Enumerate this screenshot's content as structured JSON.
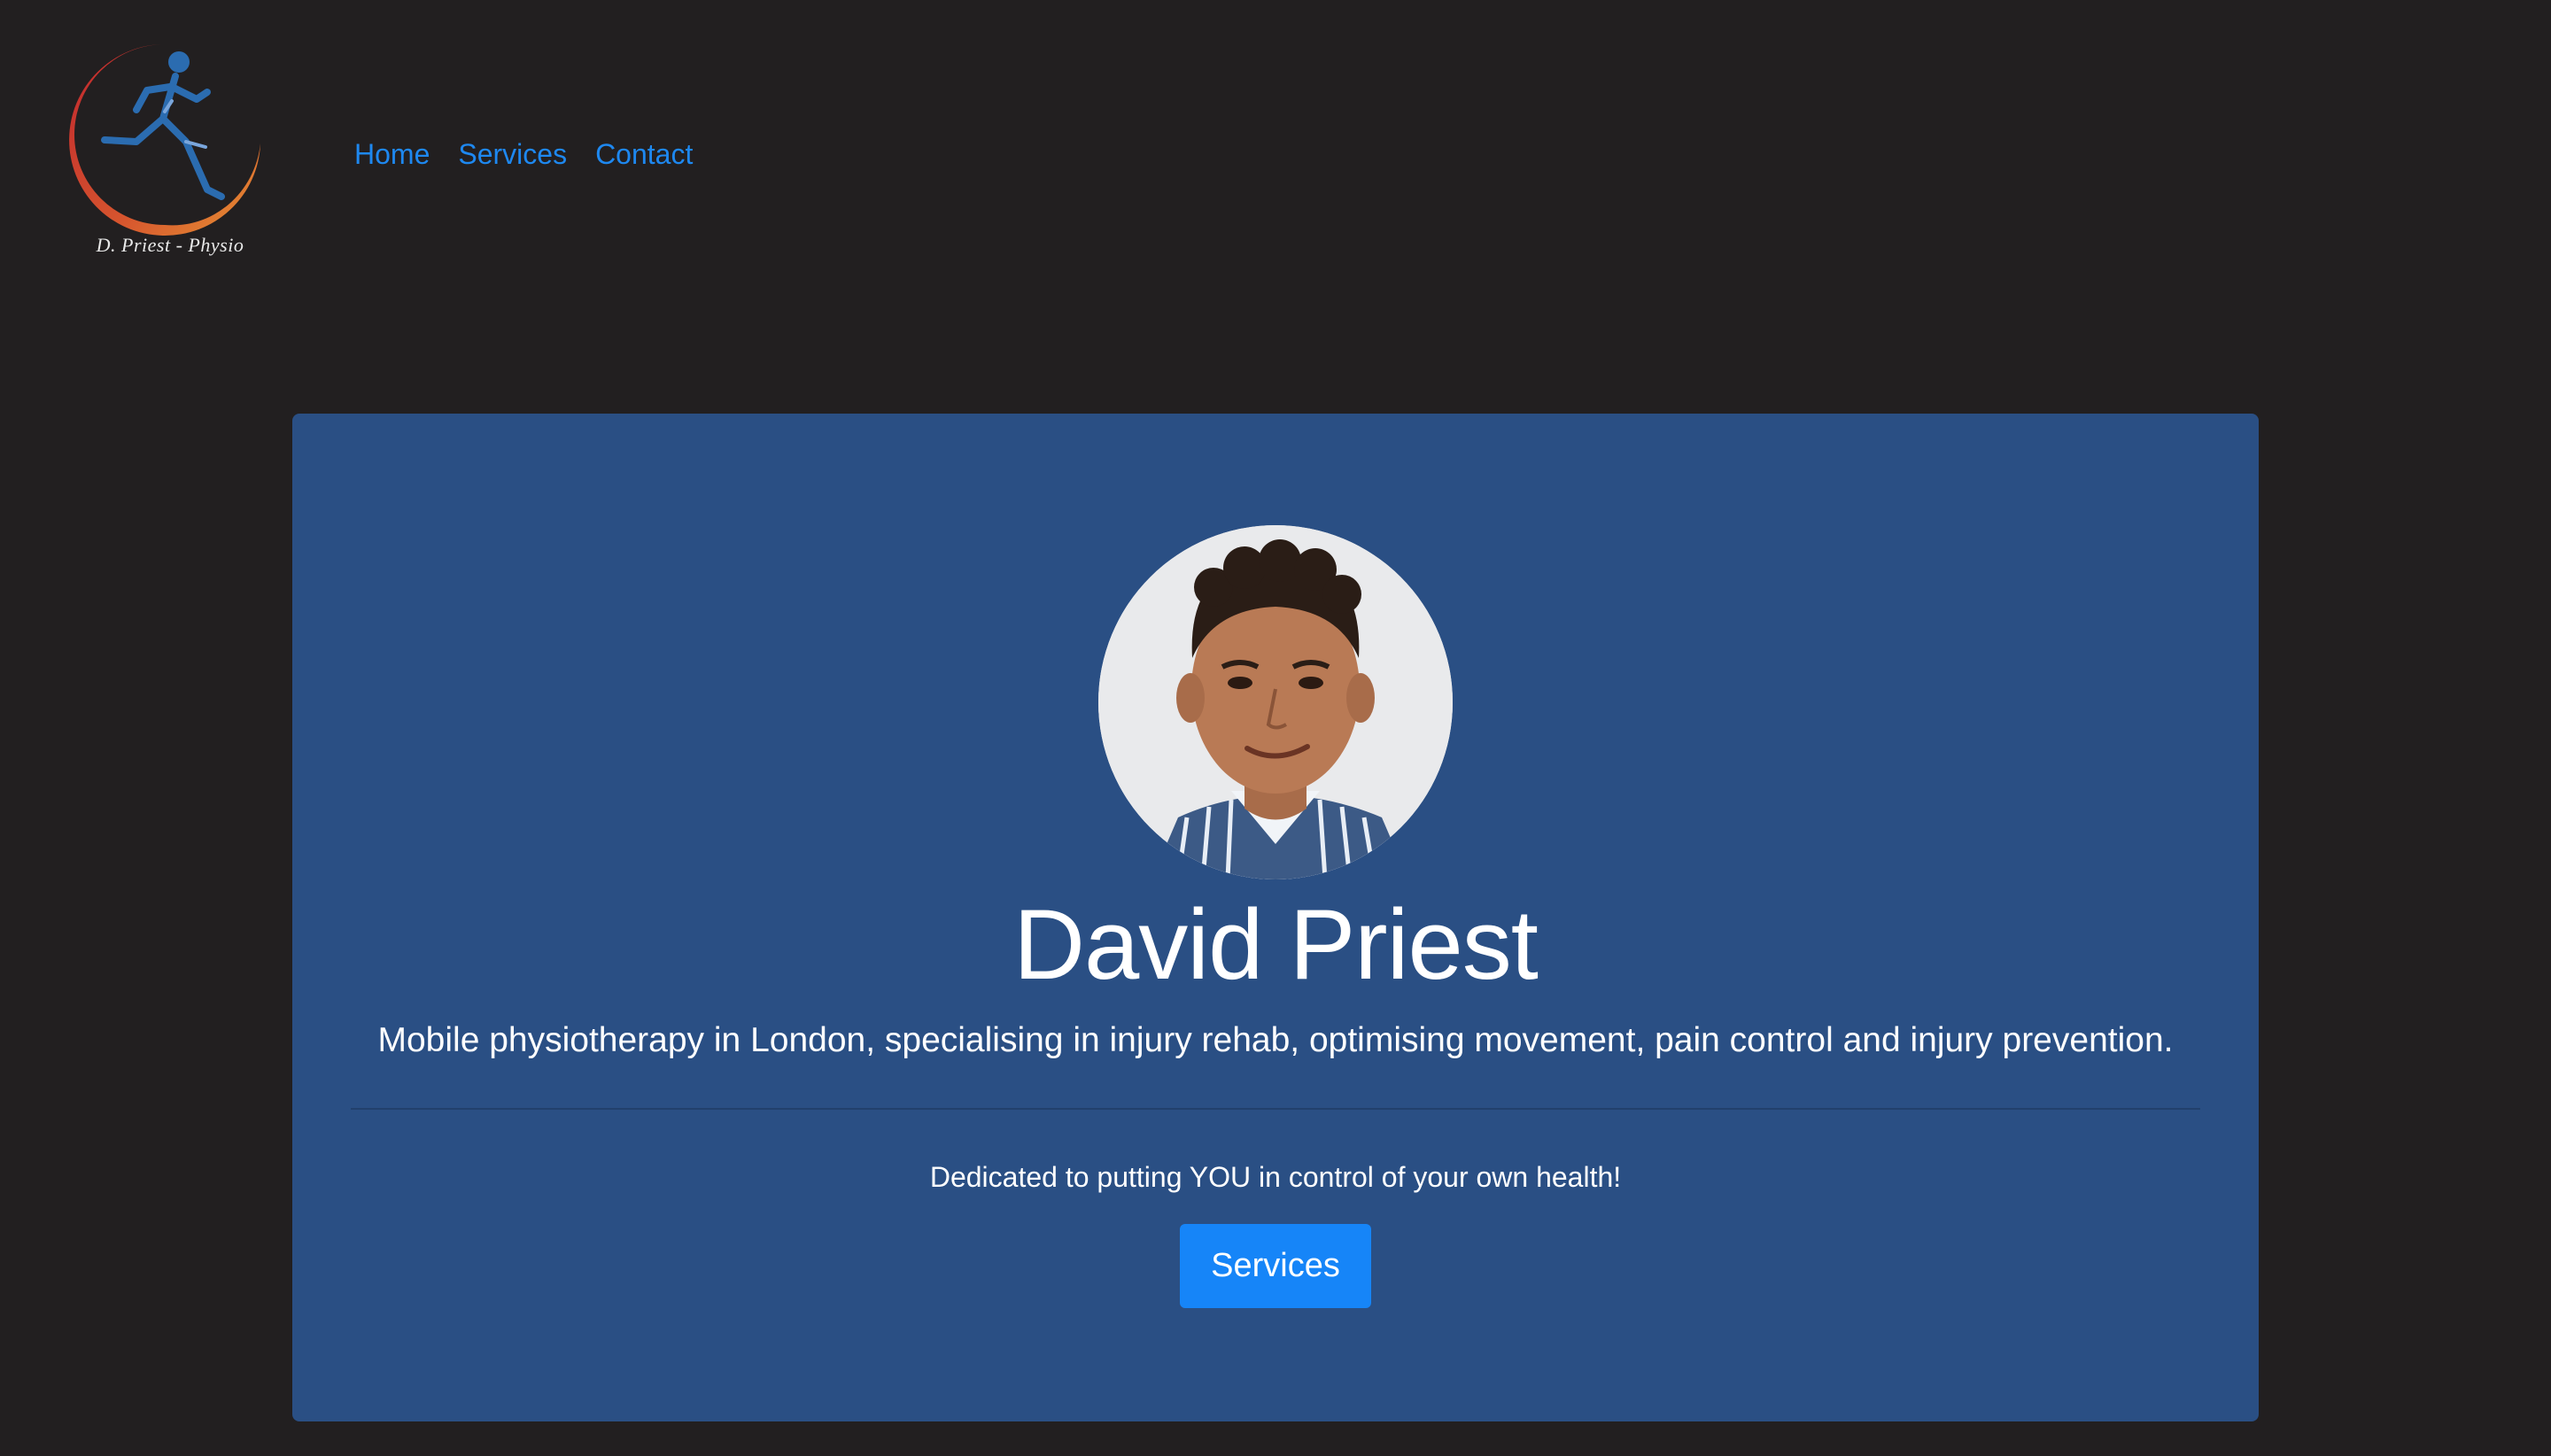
{
  "logo": {
    "text": "D. Priest - Physio",
    "icon": "runner-logo-icon",
    "colors": {
      "arc_start": "#c8262e",
      "arc_end": "#f19a34",
      "figure": "#2b6cb0"
    }
  },
  "nav": {
    "items": [
      {
        "label": "Home"
      },
      {
        "label": "Services"
      },
      {
        "label": "Contact"
      }
    ],
    "link_color": "#1e88f0"
  },
  "hero": {
    "name": "David Priest",
    "tagline": "Mobile physiotherapy in London, specialising in injury rehab, optimising movement, pain control and injury prevention.",
    "dedication": "Dedicated to putting YOU in control of your own health!",
    "button_label": "Services",
    "avatar_alt": "David Priest portrait",
    "colors": {
      "card": "#2a4f84",
      "button": "#1685f8",
      "page_bg": "#221f20"
    }
  }
}
